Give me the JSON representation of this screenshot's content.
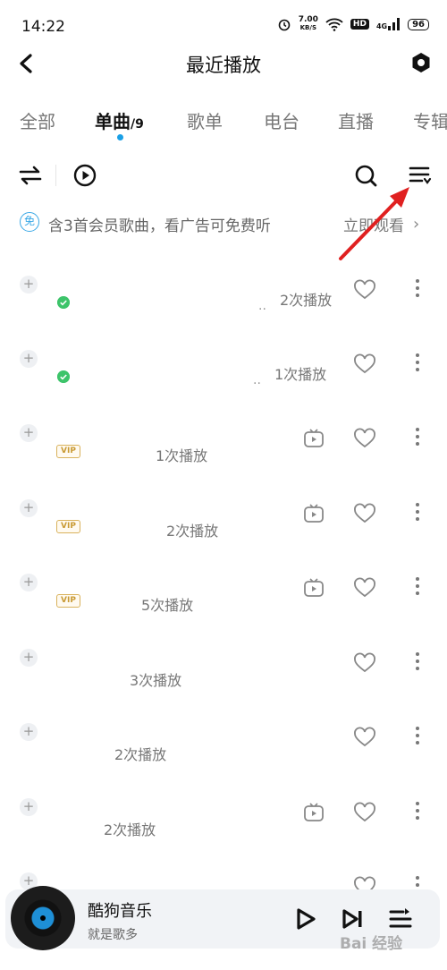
{
  "status_bar": {
    "time": "14:22",
    "speed_value": "7.00",
    "speed_unit": "KB/S",
    "hd_label": "HD",
    "network_label": "4G",
    "battery": "96"
  },
  "header": {
    "title": "最近播放"
  },
  "tabs": [
    {
      "label": "全部"
    },
    {
      "label": "单曲",
      "count": "/9"
    },
    {
      "label": "歌单"
    },
    {
      "label": "电台"
    },
    {
      "label": "直播"
    },
    {
      "label": "专辑"
    }
  ],
  "promo": {
    "badge": "免",
    "text": "含3首会员歌曲，看广告可免费听",
    "link": "立即观看"
  },
  "list": [
    {
      "dots": "..",
      "plays": "2次播放"
    },
    {
      "dots": "..",
      "plays": "1次播放"
    },
    {
      "plays": "1次播放"
    },
    {
      "plays": "2次播放"
    },
    {
      "plays": "5次播放"
    },
    {
      "plays": "3次播放"
    },
    {
      "plays": "2次播放"
    },
    {
      "plays": "2次播放"
    },
    {
      "plays": ""
    }
  ],
  "badges": {
    "vip": "VIP"
  },
  "player": {
    "title": "酷狗音乐",
    "artist": "就是歌多"
  },
  "watermark": "Bai 经验",
  "colors": {
    "accent": "#1aa0e6",
    "annotation_arrow": "#e02020",
    "vip": "#c99a34",
    "downloaded": "#3dc46a"
  }
}
